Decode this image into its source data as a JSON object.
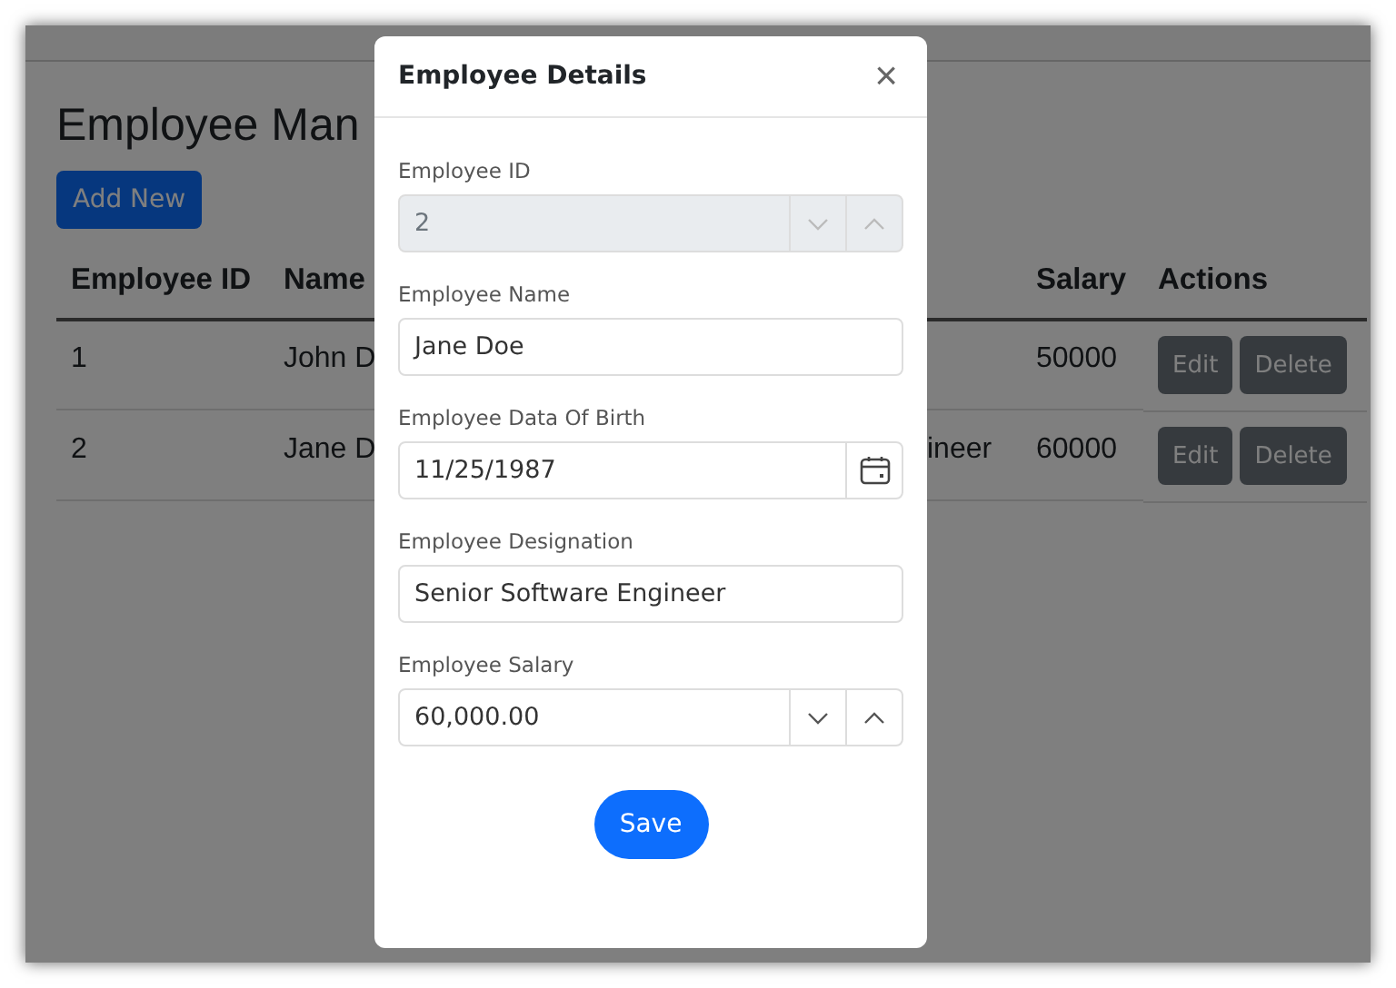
{
  "page": {
    "heading": "Employee Man",
    "add_button": "Add New",
    "table": {
      "columns": {
        "id": "Employee ID",
        "name": "Name",
        "salary": "Salary",
        "actions": "Actions"
      },
      "rows": [
        {
          "id": "1",
          "name": "John D",
          "salary": "50000",
          "actions": [
            "Edit",
            "Delete"
          ]
        },
        {
          "id": "2",
          "name": "Jane D",
          "column_3": "ineer",
          "salary": "60000",
          "actions": [
            "Edit",
            "Delete"
          ]
        }
      ]
    }
  },
  "dialog": {
    "title": "Employee Details",
    "close": "×",
    "fields": [
      {
        "label": "Employee ID",
        "value": "2",
        "kind": "number",
        "disabled": true
      },
      {
        "label": "Employee Name",
        "value": "Jane Doe",
        "kind": "text",
        "disabled": false
      },
      {
        "label": "Employee Data Of Birth",
        "value": "11/25/1987",
        "kind": "date",
        "disabled": false
      },
      {
        "label": "Employee Designation",
        "value": "Senior Software Engineer",
        "kind": "text",
        "disabled": false
      },
      {
        "label": "Employee Salary",
        "value": "60,000.00",
        "kind": "number",
        "disabled": false
      }
    ],
    "save_button": "Save"
  }
}
